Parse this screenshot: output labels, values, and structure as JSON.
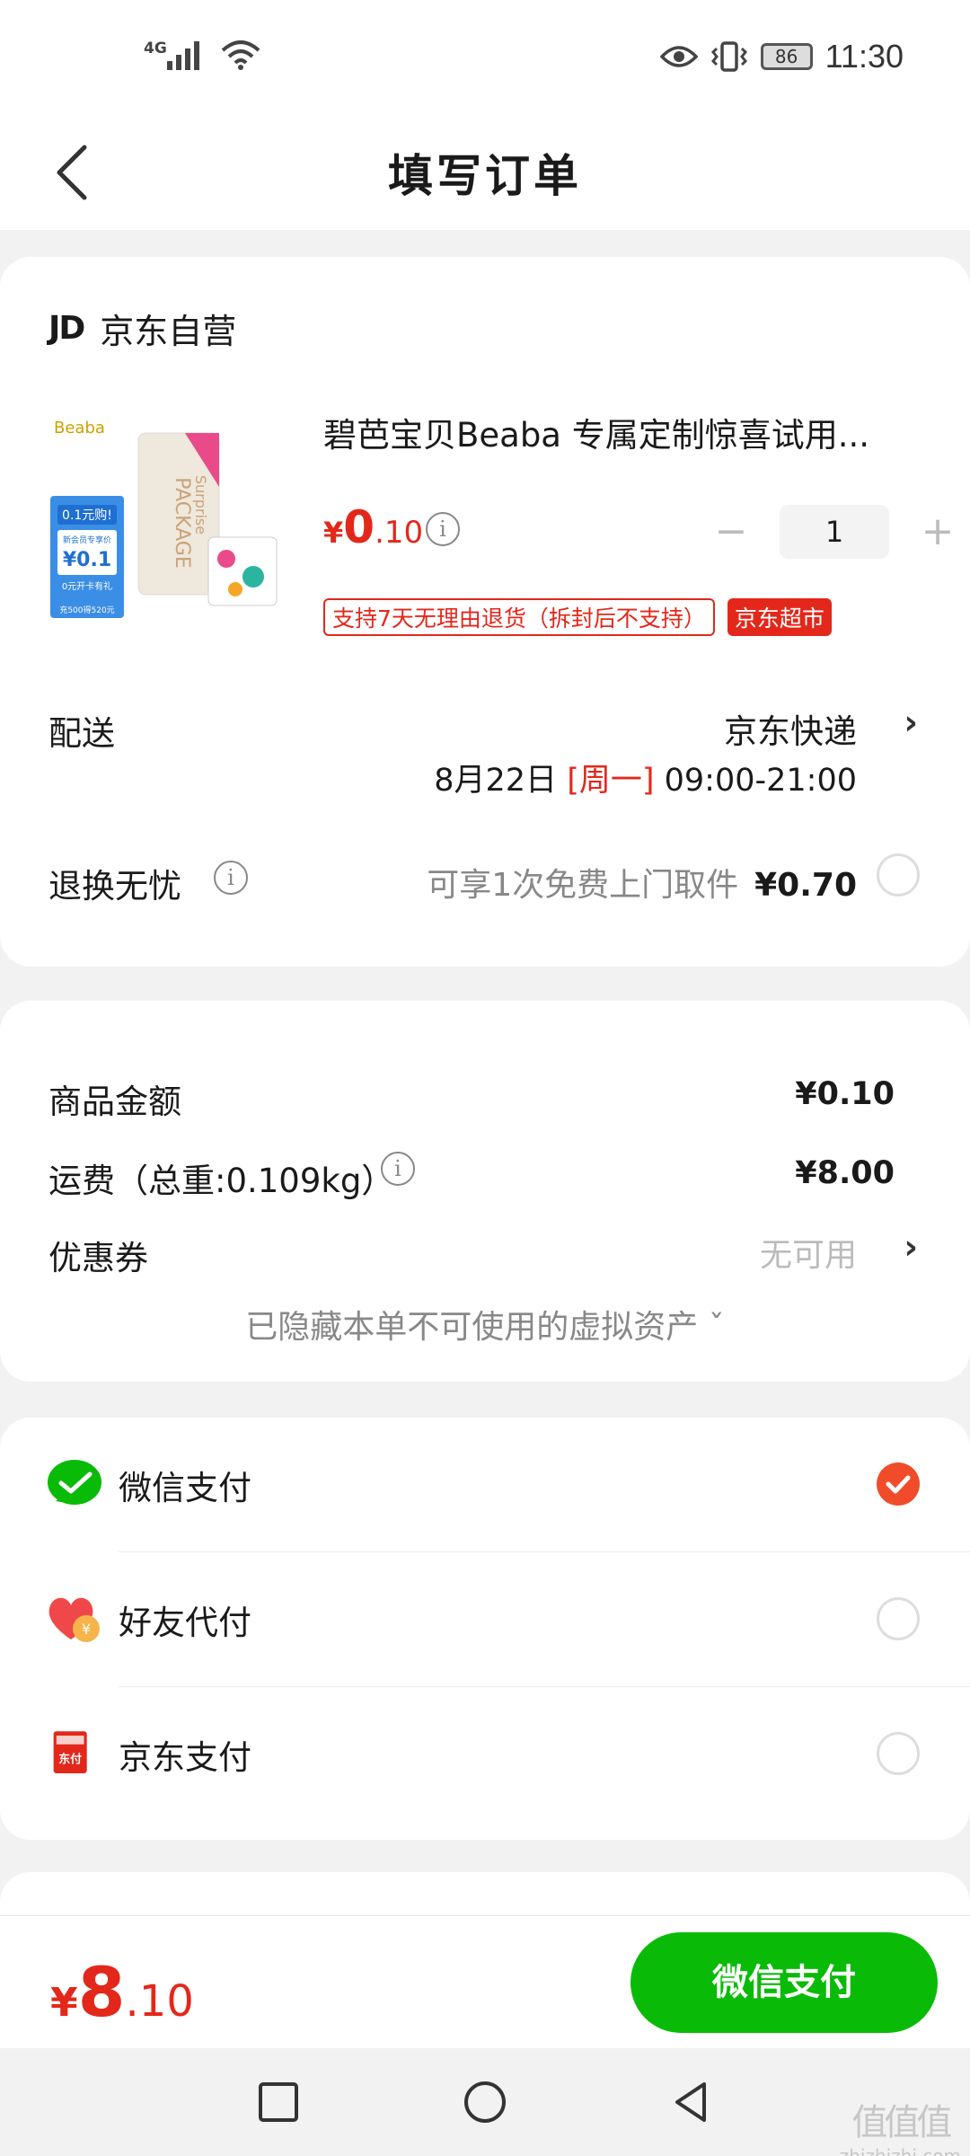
{
  "status_bar": {
    "network": "4G",
    "battery": "86",
    "time": "11:30"
  },
  "header": {
    "title": "填写订单"
  },
  "shop": {
    "logo": "JD",
    "name": "京东自营"
  },
  "product": {
    "name": "碧芭宝贝Beaba 专属定制惊喜试用...",
    "price_symbol": "¥",
    "price_int": "0",
    "price_dec": ".10",
    "quantity": "1",
    "tag_return": "支持7天无理由退货（拆封后不支持）",
    "tag_market": "京东超市",
    "image": {
      "brand": "Beaba",
      "promo_title": "0.1元购!",
      "promo_sub": "新会员专享价",
      "promo_price": "¥0.1",
      "promo_note": "0元开卡有礼",
      "promo_bottom": "充500得520元",
      "package_text": "PACKAGE",
      "surprise_text": "Surprise"
    }
  },
  "delivery": {
    "label": "配送",
    "method": "京东快递",
    "date": "8月22日",
    "weekday": "[周一]",
    "time": "09:00-21:00"
  },
  "return_service": {
    "label": "退换无忧",
    "desc": "可享1次免费上门取件",
    "price": "¥0.70"
  },
  "amounts": {
    "goods_label": "商品金额",
    "goods_value": "¥0.10",
    "freight_label": "运费（总重:0.109kg）",
    "freight_value": "¥8.00",
    "coupon_label": "优惠券",
    "coupon_value": "无可用",
    "hidden_assets": "已隐藏本单不可使用的虚拟资产 ˇ"
  },
  "payment": {
    "methods": [
      {
        "label": "微信支付",
        "selected": true
      },
      {
        "label": "好友代付",
        "selected": false
      },
      {
        "label": "京东支付",
        "selected": false
      }
    ]
  },
  "bottom": {
    "total_symbol": "¥",
    "total_int": "8",
    "total_dec": ".10",
    "pay_button": "微信支付"
  },
  "watermark": {
    "site": "zhizhizhi.com",
    "glyph": "值值值"
  },
  "colors": {
    "accent_red": "#e3281b",
    "wechat_green": "#09bb07",
    "check_orange": "#f14c2a"
  }
}
